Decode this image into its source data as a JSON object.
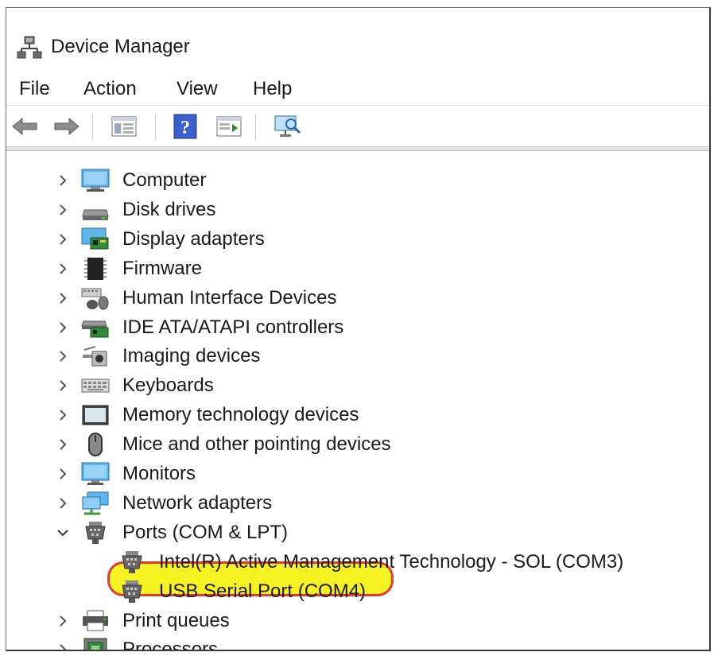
{
  "window": {
    "title": "Device Manager",
    "title_icon": "device-manager-icon"
  },
  "menu": [
    {
      "label": "File"
    },
    {
      "label": "Action"
    },
    {
      "label": "View"
    },
    {
      "label": "Help"
    }
  ],
  "toolbar": {
    "buttons": [
      {
        "icon": "back-arrow-icon"
      },
      {
        "icon": "forward-arrow-icon"
      },
      {
        "icon": "show-hide-console-tree-icon"
      },
      {
        "icon": "help-icon"
      },
      {
        "icon": "properties-pane-icon"
      },
      {
        "icon": "scan-hardware-icon"
      }
    ]
  },
  "tree": {
    "items": [
      {
        "label": "Computer",
        "icon": "computer-icon",
        "expanded": false
      },
      {
        "label": "Disk drives",
        "icon": "disk-drive-icon",
        "expanded": false
      },
      {
        "label": "Display adapters",
        "icon": "display-adapter-icon",
        "expanded": false
      },
      {
        "label": "Firmware",
        "icon": "firmware-chip-icon",
        "expanded": false
      },
      {
        "label": "Human Interface Devices",
        "icon": "hid-icon",
        "expanded": false
      },
      {
        "label": "IDE ATA/ATAPI controllers",
        "icon": "ide-controller-icon",
        "expanded": false
      },
      {
        "label": "Imaging devices",
        "icon": "camera-icon",
        "expanded": false
      },
      {
        "label": "Keyboards",
        "icon": "keyboard-icon",
        "expanded": false
      },
      {
        "label": "Memory technology devices",
        "icon": "memory-device-icon",
        "expanded": false
      },
      {
        "label": "Mice and other pointing devices",
        "icon": "mouse-icon",
        "expanded": false
      },
      {
        "label": "Monitors",
        "icon": "monitor-icon",
        "expanded": false
      },
      {
        "label": "Network adapters",
        "icon": "network-adapter-icon",
        "expanded": false
      },
      {
        "label": "Ports (COM & LPT)",
        "icon": "port-connector-icon",
        "expanded": true
      },
      {
        "label": "Intel(R) Active Management Technology - SOL (COM3)",
        "icon": "port-connector-icon",
        "child": true
      },
      {
        "label": "USB Serial Port (COM4)",
        "icon": "port-connector-icon",
        "child": true,
        "highlighted": true
      },
      {
        "label": "Print queues",
        "icon": "printer-icon",
        "expanded": false
      },
      {
        "label": "Processors",
        "icon": "processor-icon",
        "expanded": false
      }
    ]
  },
  "colors": {
    "highlight_fill": "#f7f323",
    "highlight_border": "#e03a3a"
  }
}
